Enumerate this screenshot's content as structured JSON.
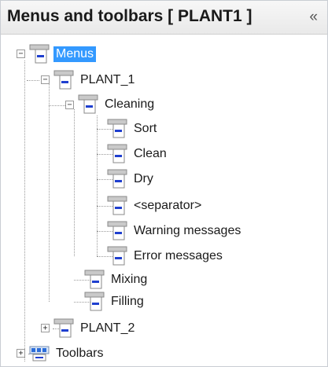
{
  "panel": {
    "title": "Menus and toolbars [ PLANT1 ]",
    "collapse_glyph": "«",
    "collapse_icon": "double-chevron-left-icon"
  },
  "tree": {
    "expanders": {
      "expanded": "−",
      "collapsed": "+"
    },
    "menus": "Menus",
    "plant_1": "PLANT_1",
    "cleaning": "Cleaning",
    "sort": "Sort",
    "clean": "Clean",
    "dry": "Dry",
    "separator": "<separator>",
    "warning_messages": "Warning messages",
    "error_messages": "Error messages",
    "mixing": "Mixing",
    "filling": "Filling",
    "plant_2": "PLANT_2",
    "toolbars": "Toolbars"
  },
  "icons": {
    "menu": "menu-item-icon",
    "toolbar": "toolbar-icon"
  },
  "colors": {
    "selection": "#3399ff",
    "menu_icon": "#1f3fcf",
    "toolbar_icon": "#2b6cd8"
  }
}
